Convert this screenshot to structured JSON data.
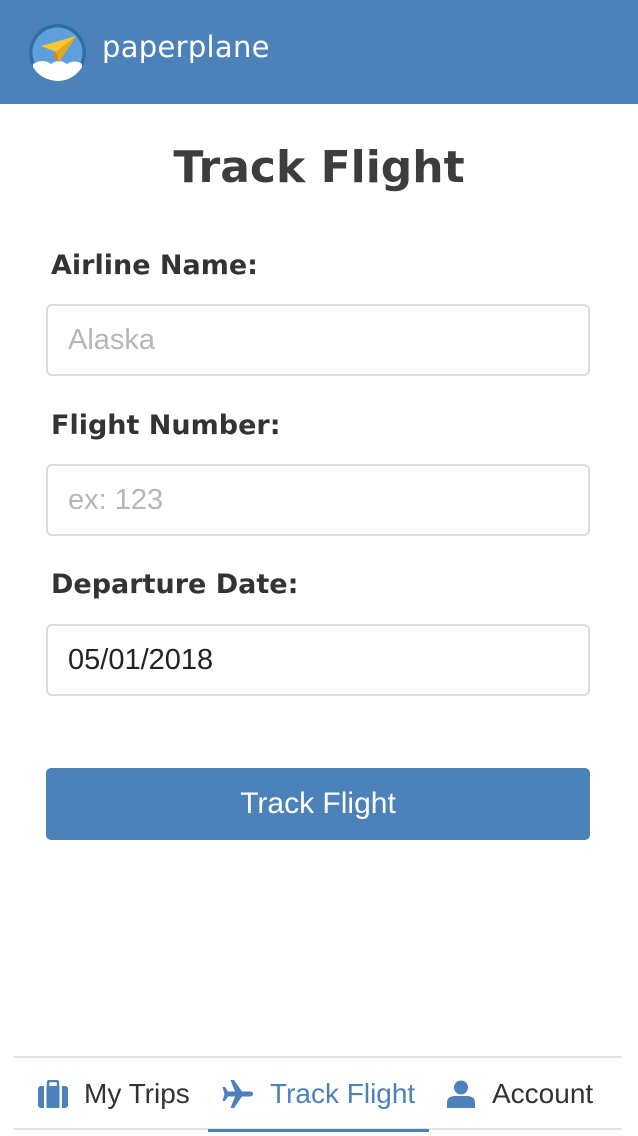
{
  "header": {
    "brand": "paperplane",
    "logo_icon": "paper-plane-logo-icon",
    "brand_color": "#4c82b9"
  },
  "main": {
    "title": "Track Flight",
    "fields": [
      {
        "label": "Airline Name:",
        "value": "",
        "placeholder": "Alaska"
      },
      {
        "label": "Flight Number:",
        "value": "",
        "placeholder": "ex: 123"
      },
      {
        "label": "Departure Date:",
        "value": "05/01/2018",
        "placeholder": ""
      }
    ],
    "submit_label": "Track Flight"
  },
  "bottom_nav": {
    "items": [
      {
        "label": "My Trips",
        "icon": "suitcase-icon",
        "active": false
      },
      {
        "label": "Track Flight",
        "icon": "airplane-icon",
        "active": true
      },
      {
        "label": "Account",
        "icon": "user-icon",
        "active": false
      }
    ],
    "active_color": "#4c82b9"
  }
}
